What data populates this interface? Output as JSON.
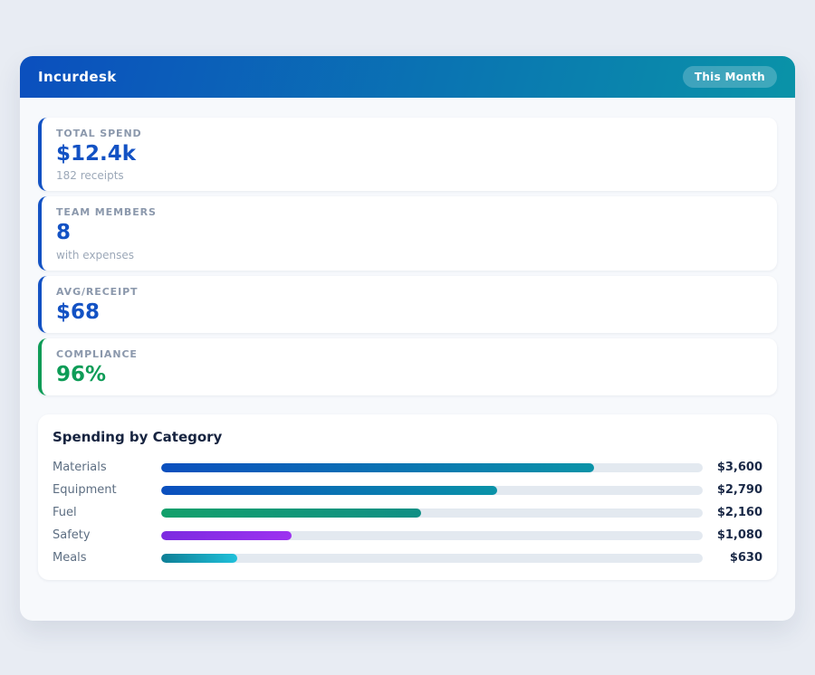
{
  "theme": {
    "header_gradient": [
      "#0b4fbe",
      "#0a93a8"
    ],
    "page_background": "#e8ecf3",
    "container_background": "#f7f9fc",
    "track_color": "#e3e9f0",
    "value_text_color": "#1a2947"
  },
  "header": {
    "title": "Incurdesk",
    "period_badge": "This Month"
  },
  "stats": [
    {
      "label": "TOTAL SPEND",
      "value": "$12.4k",
      "sub": "182 receipts",
      "accent": "#1352c4"
    },
    {
      "label": "TEAM MEMBERS",
      "value": "8",
      "sub": "with expenses",
      "accent": "#1352c4"
    },
    {
      "label": "AVG/RECEIPT",
      "value": "$68",
      "sub": null,
      "accent": "#1352c4"
    },
    {
      "label": "COMPLIANCE",
      "value": "96%",
      "sub": null,
      "accent": "#0e9c57"
    }
  ],
  "chart_data": {
    "type": "bar",
    "orientation": "horizontal",
    "title": "Spending by Category",
    "categories": [
      "Materials",
      "Equipment",
      "Fuel",
      "Safety",
      "Meals"
    ],
    "values": [
      3600,
      2790,
      2160,
      1080,
      630
    ],
    "value_labels": [
      "$3,600",
      "$2,790",
      "$2,160",
      "$1,080",
      "$630"
    ],
    "scale_max": 4500,
    "grid": false,
    "legend": "none",
    "bar_gradients": [
      [
        "#0b4fbe",
        "#0a93a8"
      ],
      [
        "#0b4fbe",
        "#0a93a8"
      ],
      [
        "#12a06b",
        "#0f8f85"
      ],
      [
        "#7c2be0",
        "#9d32f0"
      ],
      [
        "#0e7f96",
        "#20c0da"
      ]
    ]
  }
}
